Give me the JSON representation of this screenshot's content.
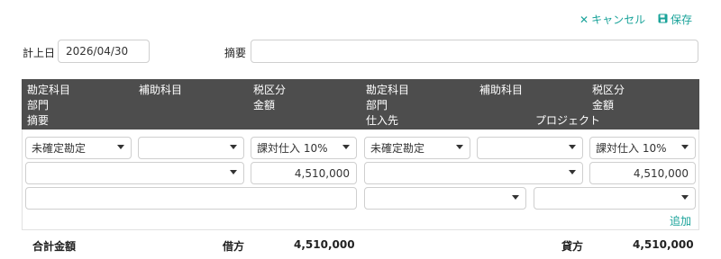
{
  "toolbar": {
    "cancel_label": "キャンセル",
    "save_label": "保存",
    "accent_color": "#1aa39a"
  },
  "form": {
    "date_label": "計上日",
    "date_value": "2026/04/30",
    "memo_label": "摘要",
    "memo_value": ""
  },
  "header": {
    "debit": {
      "account": "勘定科目",
      "sub_account": "補助科目",
      "tax_class": "税区分",
      "department": "部門",
      "amount": "金額",
      "memo": "摘要"
    },
    "credit": {
      "account": "勘定科目",
      "sub_account": "補助科目",
      "tax_class": "税区分",
      "department": "部門",
      "amount": "金額",
      "supplier": "仕入先",
      "project": "プロジェクト"
    }
  },
  "row": {
    "debit": {
      "account": "未確定勘定",
      "sub_account": "",
      "tax_class": "課対仕入 10%",
      "department": "",
      "amount": "4,510,000",
      "memo": ""
    },
    "credit": {
      "account": "未確定勘定",
      "sub_account": "",
      "tax_class": "課対仕入 10%",
      "department": "",
      "amount": "4,510,000",
      "supplier": "",
      "project": ""
    }
  },
  "add_label": "追加",
  "totals": {
    "label": "合計金額",
    "debit_label": "借方",
    "debit_value": "4,510,000",
    "credit_label": "貸方",
    "credit_value": "4,510,000"
  }
}
